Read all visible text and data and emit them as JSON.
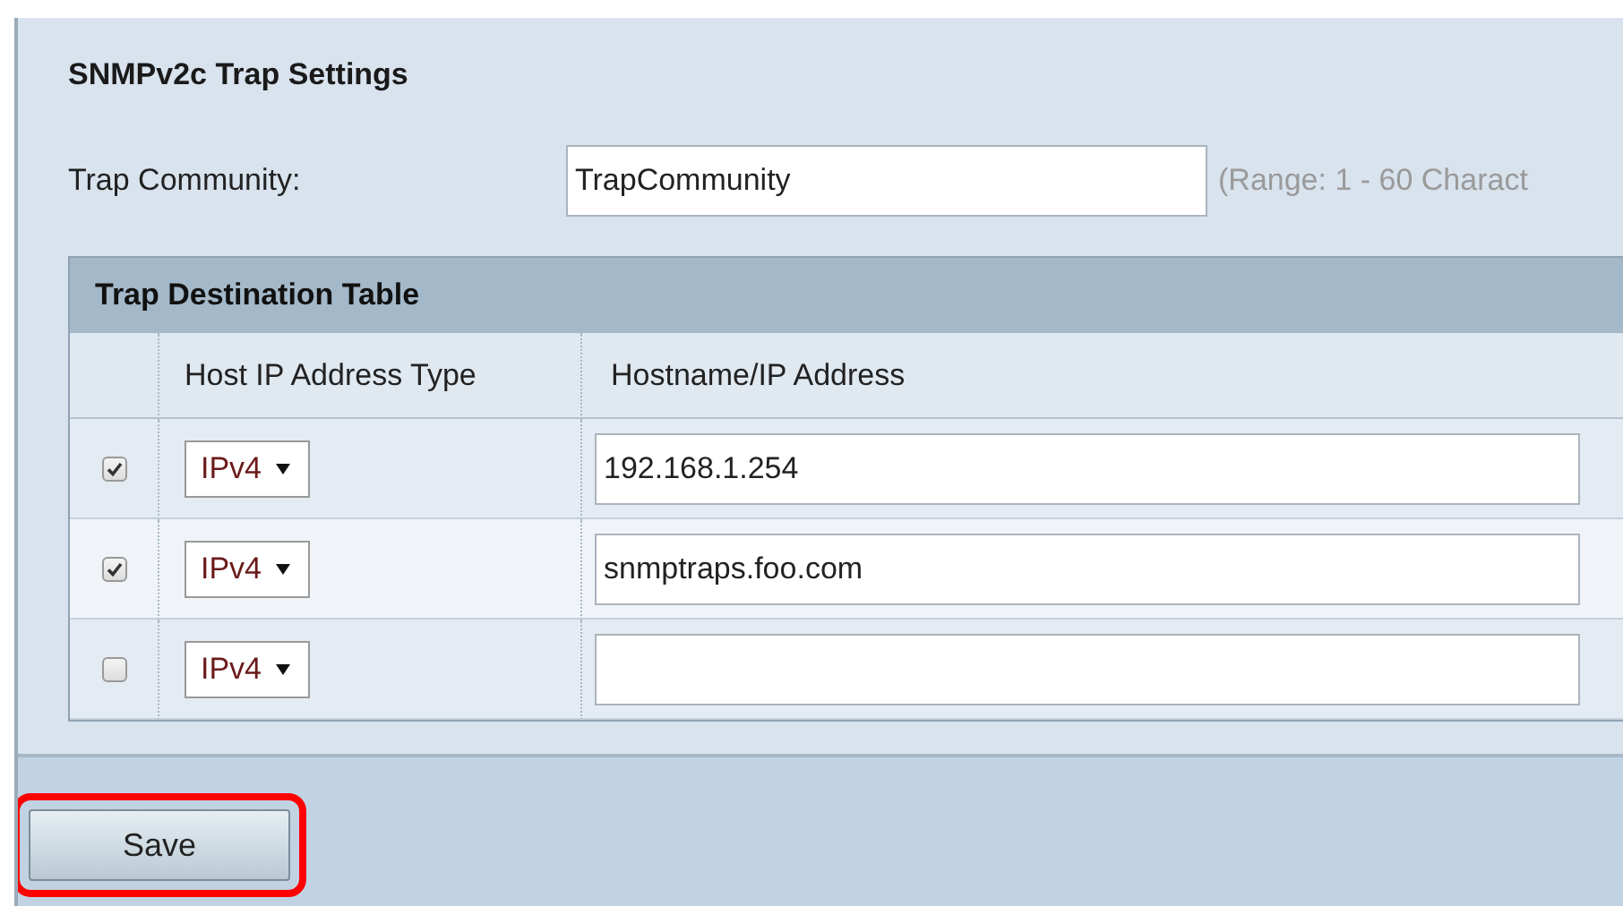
{
  "section": {
    "title": "SNMPv2c Trap Settings"
  },
  "trap_community": {
    "label": "Trap Community:",
    "value": "TrapCommunity",
    "hint": "(Range: 1 - 60 Charact"
  },
  "table": {
    "title": "Trap Destination Table",
    "columns": [
      "Host IP Address Type",
      "Hostname/IP Address"
    ],
    "rows": [
      {
        "checked": true,
        "type": "IPv4",
        "address": "192.168.1.254"
      },
      {
        "checked": true,
        "type": "IPv4",
        "address": "snmptraps.foo.com"
      },
      {
        "checked": false,
        "type": "IPv4",
        "address": ""
      }
    ]
  },
  "buttons": [
    {
      "label": "Save",
      "highlighted": true
    }
  ]
}
